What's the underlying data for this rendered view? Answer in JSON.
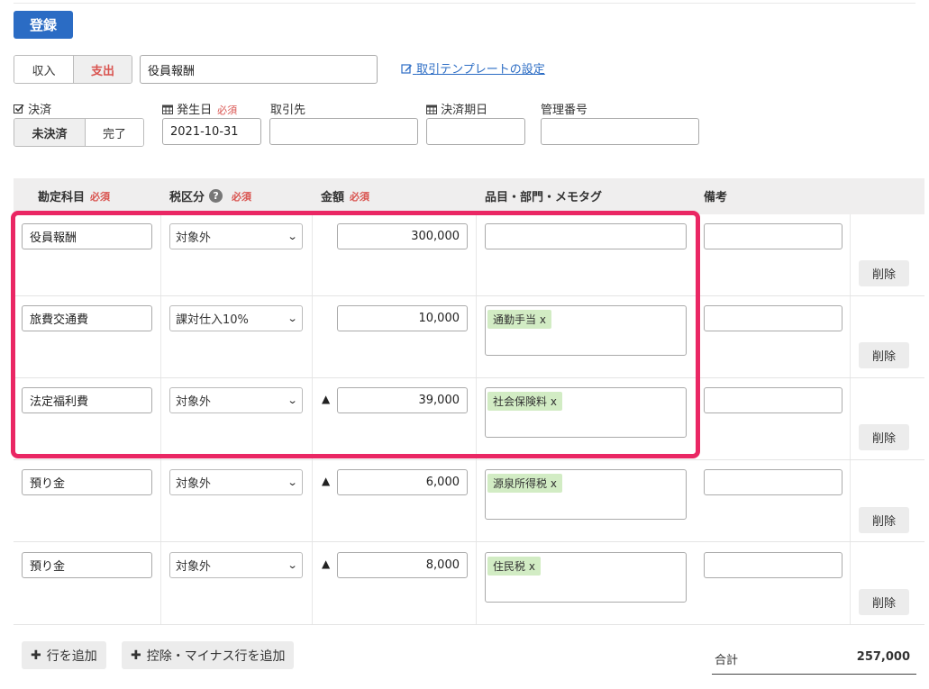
{
  "toolbar": {
    "register_label": "登録"
  },
  "type_toggle": {
    "income": "収入",
    "expense": "支出"
  },
  "description": "役員報酬",
  "template_link": "取引テンプレートの設定",
  "settlement": {
    "label": "決済",
    "unsettled": "未決済",
    "done": "完了"
  },
  "date": {
    "label": "発生日",
    "required": "必須",
    "value": "2021-10-31"
  },
  "partner": {
    "label": "取引先",
    "value": ""
  },
  "due_date": {
    "label": "決済期日",
    "value": ""
  },
  "mgmt_no": {
    "label": "管理番号",
    "value": ""
  },
  "table": {
    "headers": {
      "account": "勘定科目",
      "tax": "税区分",
      "amount": "金額",
      "items": "品目・部門・メモタグ",
      "note": "備考"
    },
    "required": "必須",
    "delete_label": "削除",
    "rows": [
      {
        "account": "役員報酬",
        "tax": "対象外",
        "minus": "",
        "amount": "300,000",
        "tag": "",
        "note": ""
      },
      {
        "account": "旅費交通費",
        "tax": "課対仕入10%",
        "minus": "",
        "amount": "10,000",
        "tag": "通勤手当 x",
        "note": ""
      },
      {
        "account": "法定福利費",
        "tax": "対象外",
        "minus": "▲",
        "amount": "39,000",
        "tag": "社会保険料 x",
        "note": ""
      },
      {
        "account": "預り金",
        "tax": "対象外",
        "minus": "▲",
        "amount": "6,000",
        "tag": "源泉所得税 x",
        "note": ""
      },
      {
        "account": "預り金",
        "tax": "対象外",
        "minus": "▲",
        "amount": "8,000",
        "tag": "住民税 x",
        "note": ""
      }
    ]
  },
  "footer": {
    "add_row": "行を追加",
    "add_minus_row": "控除・マイナス行を追加",
    "total_label": "合計",
    "total_value": "257,000"
  },
  "colors": {
    "primary": "#2b6cc4",
    "highlight": "#ea2764",
    "tag_bg": "#d2ecc4",
    "required": "#d9534f"
  }
}
